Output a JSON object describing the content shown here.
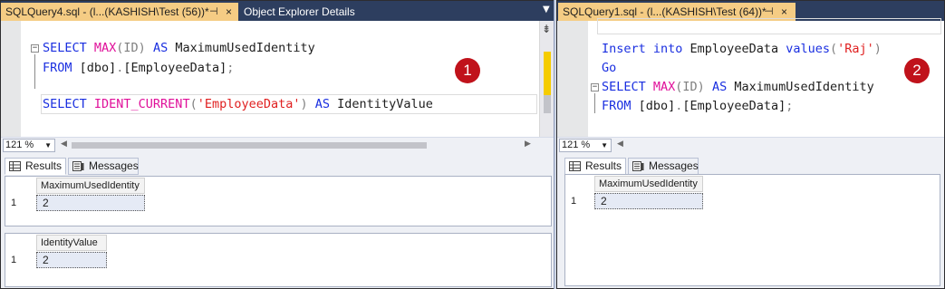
{
  "left": {
    "tabs": [
      {
        "label": "SQLQuery4.sql - (l...(KASHISH\\Test (56))*",
        "pin": "⊣",
        "close": "×"
      },
      {
        "label": "Object Explorer Details"
      }
    ],
    "code": [
      {
        "fold": "−",
        "tokens": [
          {
            "t": "SELECT ",
            "c": "kw"
          },
          {
            "t": "MAX",
            "c": "fn"
          },
          {
            "t": "(ID) ",
            "c": "gray"
          },
          {
            "t": "AS ",
            "c": "kw"
          },
          {
            "t": "MaximumUsedIdentity",
            "c": "txt"
          }
        ]
      },
      {
        "fold": "",
        "tokens": [
          {
            "t": "FROM ",
            "c": "kw"
          },
          {
            "t": "[dbo]",
            "c": "txt"
          },
          {
            "t": ".",
            "c": "gray"
          },
          {
            "t": "[EmployeeData]",
            "c": "txt"
          },
          {
            "t": ";",
            "c": "gray"
          }
        ]
      },
      {
        "fold": "",
        "tokens": []
      },
      {
        "fold": "",
        "tokens": [
          {
            "t": "SELECT ",
            "c": "kw"
          },
          {
            "t": "IDENT_CURRENT",
            "c": "fn"
          },
          {
            "t": "(",
            "c": "gray"
          },
          {
            "t": "'EmployeeData'",
            "c": "str"
          },
          {
            "t": ") ",
            "c": "gray"
          },
          {
            "t": "AS ",
            "c": "kw"
          },
          {
            "t": "IdentityValue",
            "c": "txt"
          }
        ]
      }
    ],
    "badge": "1",
    "zoom": "121 %",
    "result_tabs": [
      "Results",
      "Messages"
    ],
    "grids": [
      {
        "column": "MaximumUsedIdentity",
        "row_number": "1",
        "value": "2"
      },
      {
        "column": "IdentityValue",
        "row_number": "1",
        "value": "2"
      }
    ]
  },
  "right": {
    "tabs": [
      {
        "label": "SQLQuery1.sql - (l...(KASHISH\\Test (64))*",
        "pin": "⊣",
        "close": "×"
      }
    ],
    "code": [
      {
        "fold": "",
        "tokens": [
          {
            "t": "Insert ",
            "c": "kw"
          },
          {
            "t": "into ",
            "c": "kw"
          },
          {
            "t": "EmployeeData ",
            "c": "txt"
          },
          {
            "t": "values",
            "c": "kw"
          },
          {
            "t": "(",
            "c": "gray"
          },
          {
            "t": "'Raj'",
            "c": "str"
          },
          {
            "t": ")",
            "c": "gray"
          }
        ]
      },
      {
        "fold": "",
        "tokens": [
          {
            "t": "Go",
            "c": "kw"
          }
        ]
      },
      {
        "fold": "−",
        "tokens": [
          {
            "t": "SELECT ",
            "c": "kw"
          },
          {
            "t": "MAX",
            "c": "fn"
          },
          {
            "t": "(ID) ",
            "c": "gray"
          },
          {
            "t": "AS ",
            "c": "kw"
          },
          {
            "t": "MaximumUsedIdentity",
            "c": "txt"
          }
        ]
      },
      {
        "fold": "",
        "tokens": [
          {
            "t": "FROM ",
            "c": "kw"
          },
          {
            "t": "[dbo]",
            "c": "txt"
          },
          {
            "t": ".",
            "c": "gray"
          },
          {
            "t": "[EmployeeData]",
            "c": "txt"
          },
          {
            "t": ";",
            "c": "gray"
          }
        ]
      }
    ],
    "badge": "2",
    "zoom": "121 %",
    "result_tabs": [
      "Results",
      "Messages"
    ],
    "grids": [
      {
        "column": "MaximumUsedIdentity",
        "row_number": "1",
        "value": "2"
      }
    ]
  },
  "colors": {
    "keyword": "#1a2fe0",
    "function": "#e0109a",
    "string": "#e01f1f",
    "active_tab": "#f5cc84",
    "tab_strip": "#2d3e5f",
    "badge": "#c0121b"
  },
  "icons": [
    "pin-icon",
    "close-icon",
    "dropdown-arrow-icon",
    "fold-collapse-icon",
    "grid-results-icon",
    "messages-icon",
    "split-editor-icon"
  ]
}
